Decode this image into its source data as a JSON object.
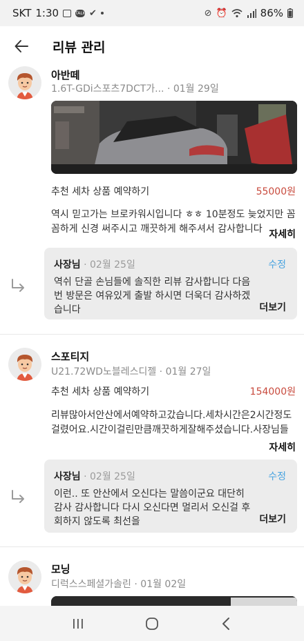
{
  "status_bar": {
    "carrier": "SKT",
    "time": "1:30",
    "battery": "86%"
  },
  "app_bar": {
    "title": "리뷰 관리"
  },
  "reviews": [
    {
      "author": "아반떼",
      "car": "1.6T-GDi스포츠7DCT가...",
      "date": "01월 29일",
      "has_photo": true,
      "product": "추천 세차 상품 예약하기",
      "price": "55000원",
      "text": "역시 믿고가는 브로카워시입니다 ㅎㅎ 10분정도 늦었지만 꼼꼼하게 신경 써주시고 깨끗하게 해주셔서 감사합니다",
      "more_label": "자세히",
      "reply": {
        "owner": "사장님",
        "date": "02월 25일",
        "edit_label": "수정",
        "text": "역쉬 단골 손님들에 솔직한 리뷰 감사합니다 다음번 방문은 여유있게 출발 하시면 더욱더 감사하겠습니다",
        "more_label": "더보기"
      }
    },
    {
      "author": "스포티지",
      "car": "U21.72WD노블레스디젤",
      "date": "01월 27일",
      "has_photo": false,
      "product": "추천 세차 상품 예약하기",
      "price": "154000원",
      "text": "리뷰많아서안산에서예약하고갔습니다.세차시간은2시간정도걸렸어요.시간이걸린만큼깨끗하게잘해주셨습니다.사장님들친절하시고세차끝나고사장님들과이야기를나누는데안산",
      "more_label": "자세히",
      "reply": {
        "owner": "사장님",
        "date": "02월 25일",
        "edit_label": "수정",
        "text": "이런.. 또 안산에서 오신다는 말씀이군요 대단히 감사 감사합니다 다시 오신다면 멀리서 오신걸 후회하지 않도록 최선을",
        "more_label": "더보기"
      }
    },
    {
      "author": "모닝",
      "car": "디럭스스페셜가솔린",
      "date": "01월 02일",
      "has_photo": true
    }
  ],
  "colors": {
    "price": "#c84a3d",
    "edit": "#4aa4e0",
    "reply_bg": "#ececec"
  }
}
